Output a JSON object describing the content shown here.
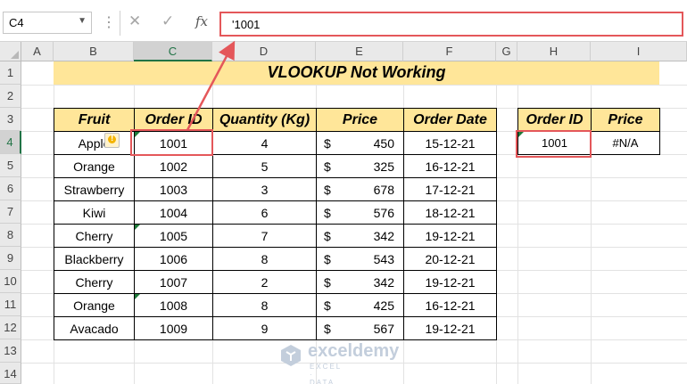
{
  "formula_bar": {
    "name_box": "C4",
    "cancel_glyph": "✕",
    "enter_glyph": "✓",
    "fx_label": "fx",
    "formula": "'1001"
  },
  "columns": [
    "A",
    "B",
    "C",
    "D",
    "E",
    "F",
    "G",
    "H",
    "I"
  ],
  "rows": [
    "1",
    "2",
    "3",
    "4",
    "5",
    "6",
    "7",
    "8",
    "9",
    "10",
    "11",
    "12",
    "13",
    "14"
  ],
  "sheet": {
    "title": "VLOOKUP Not Working",
    "main_table": {
      "headers": [
        "Fruit",
        "Order ID",
        "Quantity (Kg)",
        "Price",
        "Order Date"
      ],
      "rows": [
        {
          "fruit": "Apple",
          "order_id": "1001",
          "qty": "4",
          "currency": "$",
          "price": "450",
          "date": "15-12-21"
        },
        {
          "fruit": "Orange",
          "order_id": "1002",
          "qty": "5",
          "currency": "$",
          "price": "325",
          "date": "16-12-21"
        },
        {
          "fruit": "Strawberry",
          "order_id": "1003",
          "qty": "3",
          "currency": "$",
          "price": "678",
          "date": "17-12-21"
        },
        {
          "fruit": "Kiwi",
          "order_id": "1004",
          "qty": "6",
          "currency": "$",
          "price": "576",
          "date": "18-12-21"
        },
        {
          "fruit": "Cherry",
          "order_id": "1005",
          "qty": "7",
          "currency": "$",
          "price": "342",
          "date": "19-12-21"
        },
        {
          "fruit": "Blackberry",
          "order_id": "1006",
          "qty": "8",
          "currency": "$",
          "price": "543",
          "date": "20-12-21"
        },
        {
          "fruit": "Cherry",
          "order_id": "1007",
          "qty": "2",
          "currency": "$",
          "price": "342",
          "date": "19-12-21"
        },
        {
          "fruit": "Orange",
          "order_id": "1008",
          "qty": "8",
          "currency": "$",
          "price": "425",
          "date": "16-12-21"
        },
        {
          "fruit": "Avacado",
          "order_id": "1009",
          "qty": "9",
          "currency": "$",
          "price": "567",
          "date": "19-12-21"
        }
      ]
    },
    "lookup_table": {
      "headers": [
        "Order ID",
        "Price"
      ],
      "order_id": "1001",
      "price": "#N/A"
    },
    "warning_glyph": "!"
  },
  "watermark": {
    "name": "exceldemy",
    "tagline": "EXCEL · DATA · BI"
  },
  "colors": {
    "header_fill": "#ffe699",
    "highlight_red": "#e4575a",
    "selection_green": "#217346"
  }
}
